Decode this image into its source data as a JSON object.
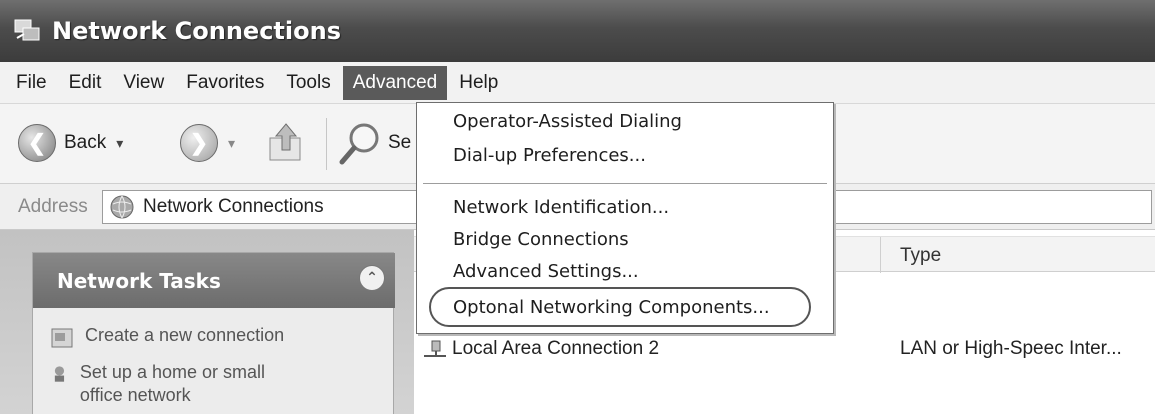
{
  "window": {
    "title": "Network Connections"
  },
  "menubar": {
    "items": [
      "File",
      "Edit",
      "View",
      "Favorites",
      "Tools",
      "Advanced",
      "Help"
    ]
  },
  "toolbar": {
    "back_label": "Back",
    "search_label_partial": "Se"
  },
  "address": {
    "label": "Address",
    "value": "Network Connections"
  },
  "taskpane": {
    "title": "Network Tasks",
    "items": [
      "Create a new connection",
      "Set up a home or small office network"
    ]
  },
  "list": {
    "column_type": "Type",
    "rows": [
      {
        "name": "Local Area Connection 2",
        "type": "LAN or High-Speec Inter..."
      }
    ]
  },
  "dropdown": {
    "items": [
      "Operator-Assisted Dialing",
      "Dial-up Preferences...",
      "Network Identification...",
      "Bridge Connections",
      "Advanced Settings...",
      "Optonal Networking Components..."
    ]
  },
  "colors": {
    "menu_active": "#5a5a5a",
    "titlebar": "#4c4c4c"
  },
  "icons": [
    "network-connections-icon",
    "back-arrow-icon",
    "forward-arrow-icon",
    "up-folder-icon",
    "search-magnifier-icon",
    "network-globe-icon",
    "collapse-chevrons-icon",
    "new-connection-icon",
    "home-network-icon",
    "lan-connection-icon"
  ]
}
